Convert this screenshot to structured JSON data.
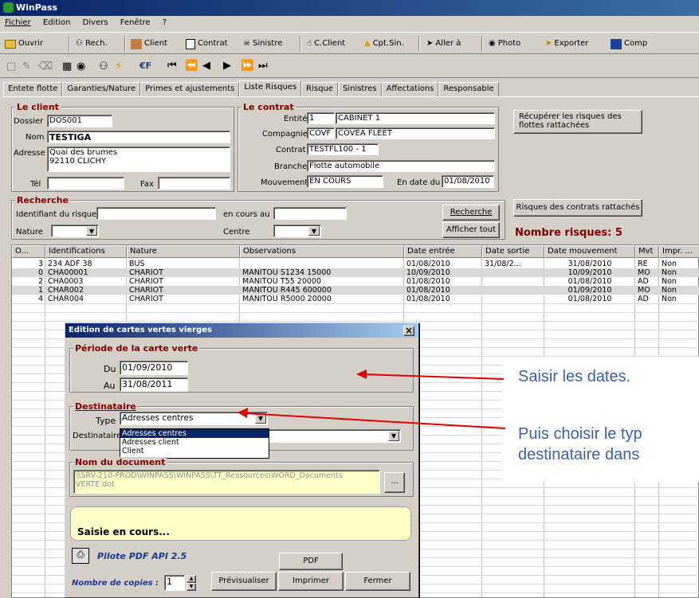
{
  "window": {
    "title": "WinPass"
  },
  "menu": [
    "Fichier",
    "Edition",
    "Divers",
    "Fenêtre",
    "?"
  ],
  "toolbar": {
    "ouvrir": "Ouvrir",
    "rech": "Rech.",
    "client": "Client",
    "contrat": "Contrat",
    "sinistre": "Sinistre",
    "c_client": "C.Client",
    "cpt_sin": "Cpt.Sin.",
    "aller": "Aller à",
    "photo": "Photo",
    "exporter": "Exporter",
    "comp": "Comp"
  },
  "tabs": [
    "Entete flotte",
    "Garanties/Nature",
    "Primes et ajustements",
    "Liste Risques",
    "Risque",
    "Sinistres",
    "Affectations",
    "Responsable"
  ],
  "client": {
    "legend": "Le client",
    "dossier_label": "Dossier",
    "dossier": "DOS001",
    "nom_label": "Nom",
    "nom": "TESTIGA",
    "adresse_label": "Adresse",
    "adresse1": "Quai des brumes",
    "adresse2": "92110 CLICHY",
    "tel_label": "Tél",
    "tel": "",
    "fax_label": "Fax",
    "fax": ""
  },
  "contrat": {
    "legend": "Le contrat",
    "entite_label": "Entité",
    "entite_code": "1",
    "entite": "CABINET 1",
    "compagnie_label": "Compagnie",
    "compagnie_code": "COVF",
    "compagnie": "COVEA FLEET",
    "contrat_label": "Contrat",
    "contrat": "TESTFL100 - 1",
    "branche_label": "Branche",
    "branche": "Flotte automobile",
    "mouvement_label": "Mouvement",
    "mouvement": "EN COURS",
    "date_label": "En date du",
    "date": "01/08/2010"
  },
  "recuperer_button": "Récupérer les risques des flottes rattachées",
  "recherche": {
    "legend": "Recherche",
    "identifiant_label": "Identifiant du risque",
    "en_cours_label": "en cours au",
    "nature_label": "Nature",
    "centre_label": "Centre",
    "recherche_button": "Recherche",
    "afficher_button": "Afficher tout"
  },
  "risques_contrats_button": "Risques des contrats rattachés",
  "nombre_risques": "Nombre risques: 5",
  "grid": {
    "headers": [
      "O...",
      "Identifications",
      "Nature",
      "Observations",
      "Date entrée",
      "Date sortie",
      "Date mouvement",
      "Mvt",
      "Impr. ..."
    ],
    "rows": [
      [
        "3",
        "234 ADF 38",
        "BUS",
        "",
        "01/08/2010",
        "31/08/2...",
        "31/08/2010",
        "RE",
        "Non"
      ],
      [
        "0",
        "CHA00001",
        "CHARIOT",
        "MANITOU S1234  15000",
        "10/09/2010",
        "",
        "10/09/2010",
        "MO",
        "Non"
      ],
      [
        "2",
        "CHA0003",
        "CHARIOT",
        "MANITOU T55  20000",
        "01/08/2010",
        "",
        "01/08/2010",
        "AD",
        "Non"
      ],
      [
        "1",
        "CHAR002",
        "CHARIOT",
        "MANITOU R445  600000",
        "01/08/2010",
        "",
        "01/09/2010",
        "MO",
        "Non"
      ],
      [
        "4",
        "CHAR004",
        "CHARIOT",
        "MANITOU R5000  20000",
        "01/08/2010",
        "",
        "01/08/2010",
        "AD",
        "Non"
      ]
    ]
  },
  "dialog": {
    "title": "Edition de cartes vertes vierges",
    "close": "×",
    "periode_legend": "Période de la carte verte",
    "du_label": "Du",
    "du": "01/09/2010",
    "au_label": "Au",
    "au": "31/08/2011",
    "destinataire_legend": "Destinataire",
    "type_label": "Type",
    "type": "Adresses centres",
    "type_options": [
      "Adresses centres",
      "Adresses client",
      "Client"
    ],
    "destinataire_label": "Destinataire",
    "document_legend": "Nom du document",
    "document": "\\\\SRV-210-PROD\\WINPASS\\WINPASS\\TT_Ressources\\WORD_Documents\\CARTEVERTE.dot",
    "document_line1": "\\\\SRV-210-PROD\\WINPASS\\WINPASS\\TT_Ressources\\WORD_Documents",
    "document_line2": "VERTE.dot",
    "browse": "...",
    "status": "Saisie en cours...",
    "pdf_driver": "Pilote PDF API 2.5",
    "pdf_button": "PDF",
    "copies_label": "Nombre de copies :",
    "copies": "1",
    "previsualiser": "Prévisualiser",
    "imprimer": "Imprimer",
    "fermer": "Fermer"
  },
  "annotations": {
    "line1": "Saisir les dates.",
    "line2": "Puis choisir le typ",
    "line3": "destinataire dans"
  },
  "colors": {
    "accent": "#0a246a",
    "legend": "#800000",
    "annotation": "#3a5fb0",
    "arrow": "#e00000"
  }
}
